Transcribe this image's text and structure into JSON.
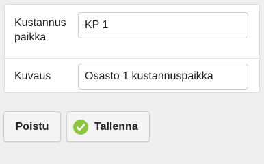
{
  "form": {
    "rows": [
      {
        "label": "Kustannus paikka",
        "value": "KP 1"
      },
      {
        "label": "Kuvaus",
        "value": "Osasto 1 kustannuspaikka"
      }
    ]
  },
  "actions": {
    "close_label": "Poistu",
    "save_label": "Tallenna",
    "save_icon": "check-circle-icon",
    "save_icon_color": "#8cc63f"
  }
}
